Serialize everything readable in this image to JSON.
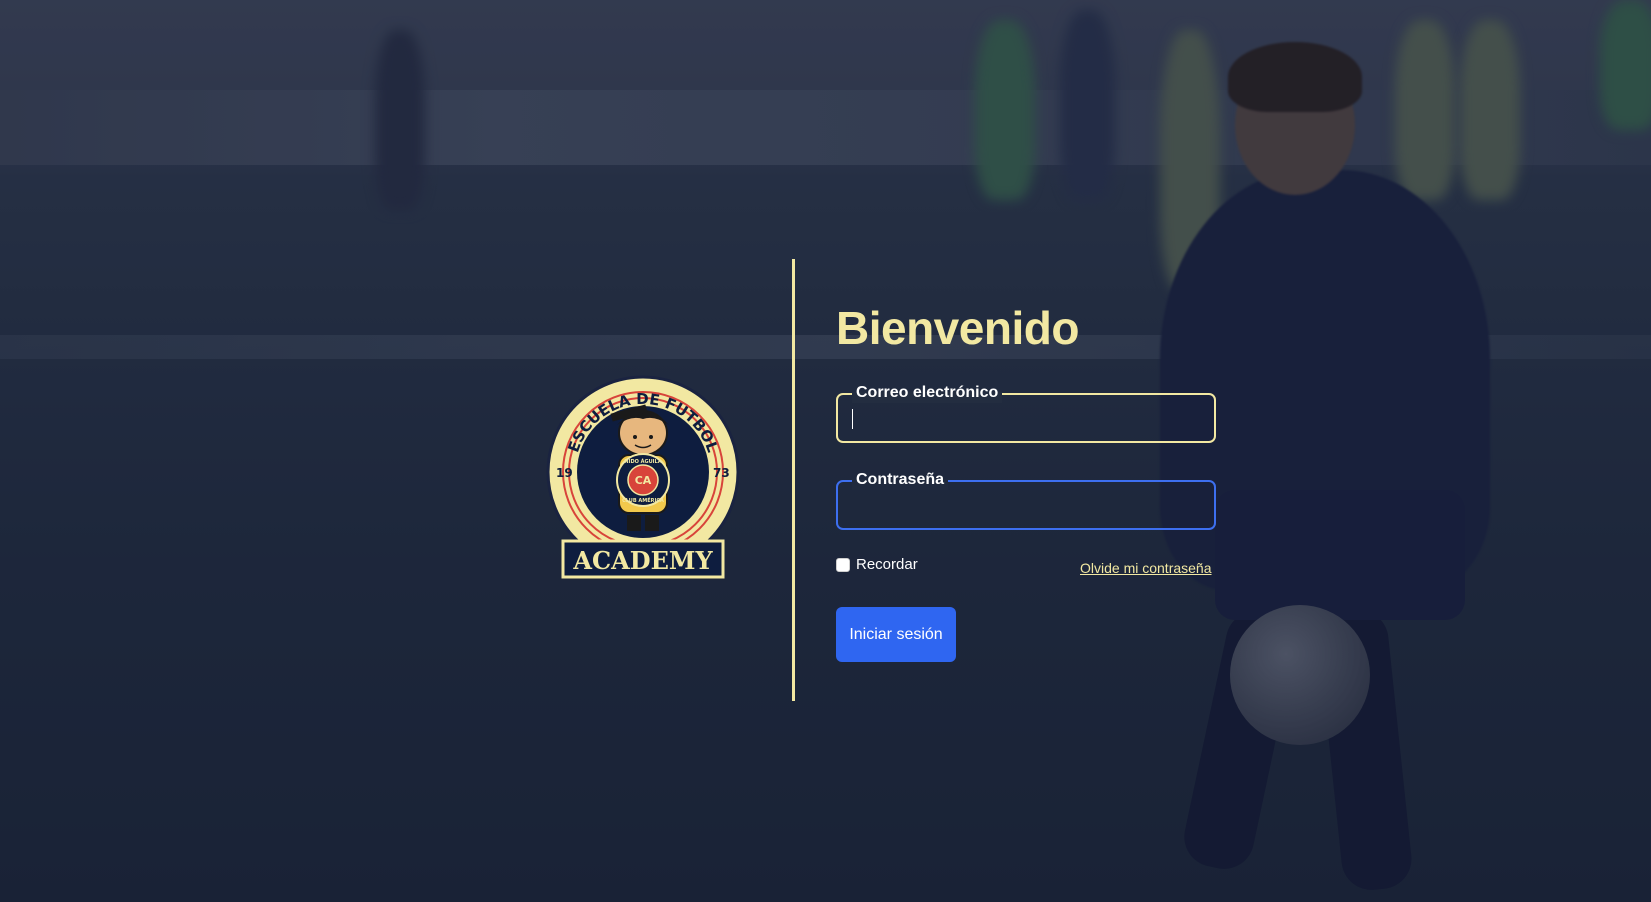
{
  "login": {
    "title": "Bienvenido",
    "email": {
      "label": "Correo electrónico",
      "value": "",
      "placeholder": ""
    },
    "password": {
      "label": "Contraseña",
      "value": "",
      "placeholder": ""
    },
    "remember_label": "Recordar",
    "remember_checked": false,
    "forgot_label": "Olvide mi contraseña",
    "submit_label": "Iniciar sesión"
  },
  "logo": {
    "top_text": "ESCUELA DE FUTBOL",
    "year_left": "19",
    "year_right": "73",
    "banner_text": "ACADEMY",
    "crest_text_top": "NIDO ÁGUILA",
    "crest_text_bottom": "CLUB AMÉRICA",
    "crest_letters": "CA"
  },
  "colors": {
    "accent_yellow": "#f2e8a2",
    "primary_blue": "#2f66f1",
    "focus_blue": "#3d6ff0",
    "logo_navy": "#0e1d3f",
    "logo_red": "#d8443a"
  }
}
